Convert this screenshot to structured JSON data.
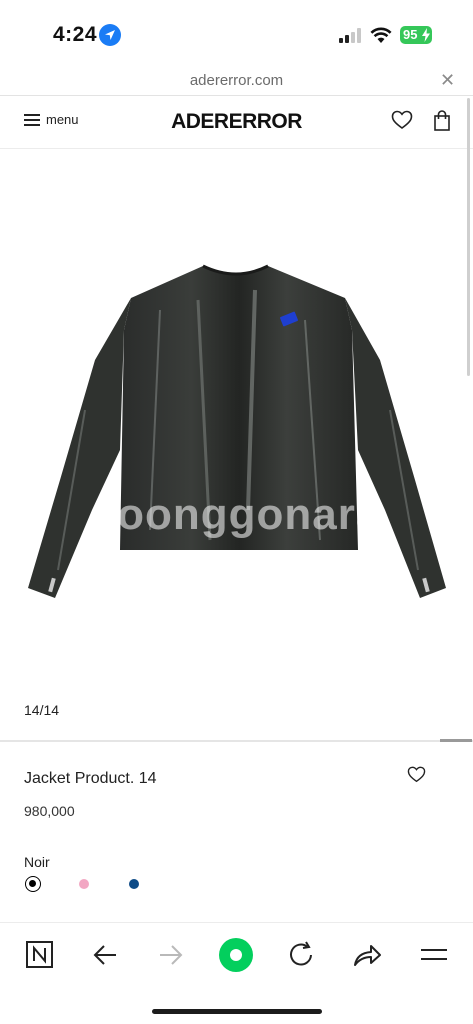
{
  "status_bar": {
    "time": "4:24",
    "battery": "95",
    "icons": [
      "location-icon",
      "signal-icon",
      "wifi-icon",
      "battery-icon"
    ]
  },
  "browser": {
    "url": "adererror.com",
    "close_icon": "close-icon"
  },
  "header": {
    "menu_label": "menu",
    "logo": "ADERERROR",
    "icons": [
      "menu-icon",
      "heart-icon",
      "bag-icon"
    ]
  },
  "gallery": {
    "watermark": "Joonggonara",
    "counter": "14/14"
  },
  "product": {
    "name": "Jacket Product. 14",
    "price": "980,000",
    "color_label": "Noir",
    "swatches": [
      {
        "name": "black",
        "color": "#000000",
        "selected": true
      },
      {
        "name": "pink",
        "color": "#f2a7c3",
        "selected": false
      },
      {
        "name": "blue",
        "color": "#0d4a86",
        "selected": false
      }
    ]
  },
  "toolbar": {
    "buttons": [
      "naver-home-icon",
      "back-icon",
      "forward-icon",
      "green-dot-icon",
      "reload-icon",
      "share-icon",
      "menu-icon"
    ]
  },
  "colors": {
    "accent_green": "#03cf5d",
    "battery_green": "#35c759",
    "location_blue": "#1a7cf5"
  }
}
